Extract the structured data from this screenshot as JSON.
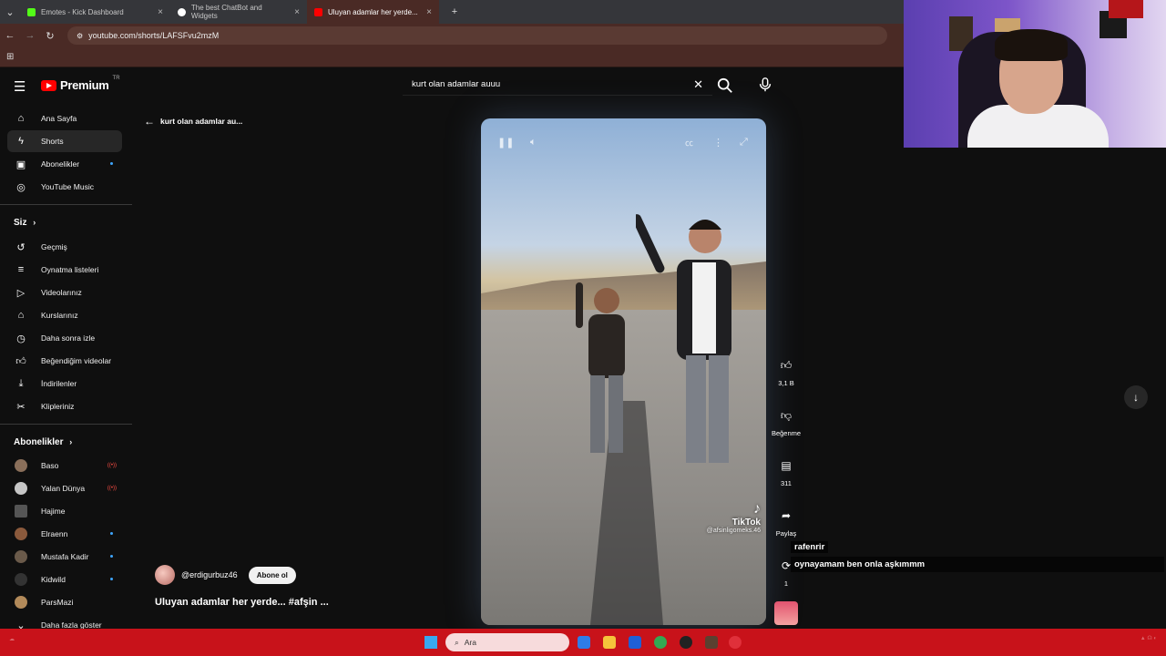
{
  "browser": {
    "tabs": [
      {
        "label": "Emotes - Kick Dashboard",
        "color": "#53fc18"
      },
      {
        "label": "The best ChatBot and Widgets",
        "color": "#ffffff"
      },
      {
        "label": "Uluyan adamlar her yerde...",
        "color": "#ff0000"
      }
    ],
    "url": "youtube.com/shorts/LAFSFvu2mzM"
  },
  "header": {
    "logo_text": "Premium",
    "logo_region": "TR",
    "search_query": "kurt olan adamlar auuu"
  },
  "sidebar": {
    "main": [
      {
        "label": "Ana Sayfa",
        "icon": "home-icon"
      },
      {
        "label": "Shorts",
        "icon": "shorts-icon"
      },
      {
        "label": "Abonelikler",
        "icon": "subscriptions-icon"
      },
      {
        "label": "YouTube Music",
        "icon": "music-icon"
      }
    ],
    "you_header": "Siz",
    "you": [
      {
        "label": "Geçmiş",
        "icon": "history-icon"
      },
      {
        "label": "Oynatma listeleri",
        "icon": "playlist-icon"
      },
      {
        "label": "Videolarınız",
        "icon": "video-icon"
      },
      {
        "label": "Kurslarınız",
        "icon": "course-icon"
      },
      {
        "label": "Daha sonra izle",
        "icon": "watch-later-icon"
      },
      {
        "label": "Beğendiğim videolar",
        "icon": "like-icon"
      },
      {
        "label": "İndirilenler",
        "icon": "download-icon"
      },
      {
        "label": "Klipleriniz",
        "icon": "clip-icon"
      }
    ],
    "subs_header": "Abonelikler",
    "subs": [
      {
        "label": "Baso",
        "color": "#8a6f5a"
      },
      {
        "label": "Yalan Dünya",
        "color": "#c6c6c6"
      },
      {
        "label": "Hajime",
        "color": "#555555"
      },
      {
        "label": "Elraenn",
        "color": "#8b5a3c"
      },
      {
        "label": "Mustafa Kadir",
        "color": "#6a5a4a"
      },
      {
        "label": "Kidwild",
        "color": "#333333"
      },
      {
        "label": "ParsMazi",
        "color": "#b28a5a"
      }
    ],
    "show_more": "Daha fazla göster"
  },
  "main": {
    "back_label": "kurt olan adamlar au...",
    "watermark": "TikTok",
    "watermark_handle": "@afsinligomeks.46",
    "actions": {
      "likes": "3,1 B",
      "dislike_label": "Beğenme",
      "comments": "311",
      "share_label": "Paylaş",
      "remix_count": "1"
    },
    "channel": "@erdigurbuz46",
    "subscribe_label": "Abone ol",
    "title": "Uluyan adamlar her yerde... #afşin ..."
  },
  "chat": {
    "user": "rafenrir",
    "message": "oynayamam ben onla aşkımmm"
  },
  "taskbar": {
    "search_placeholder": "Ara"
  }
}
